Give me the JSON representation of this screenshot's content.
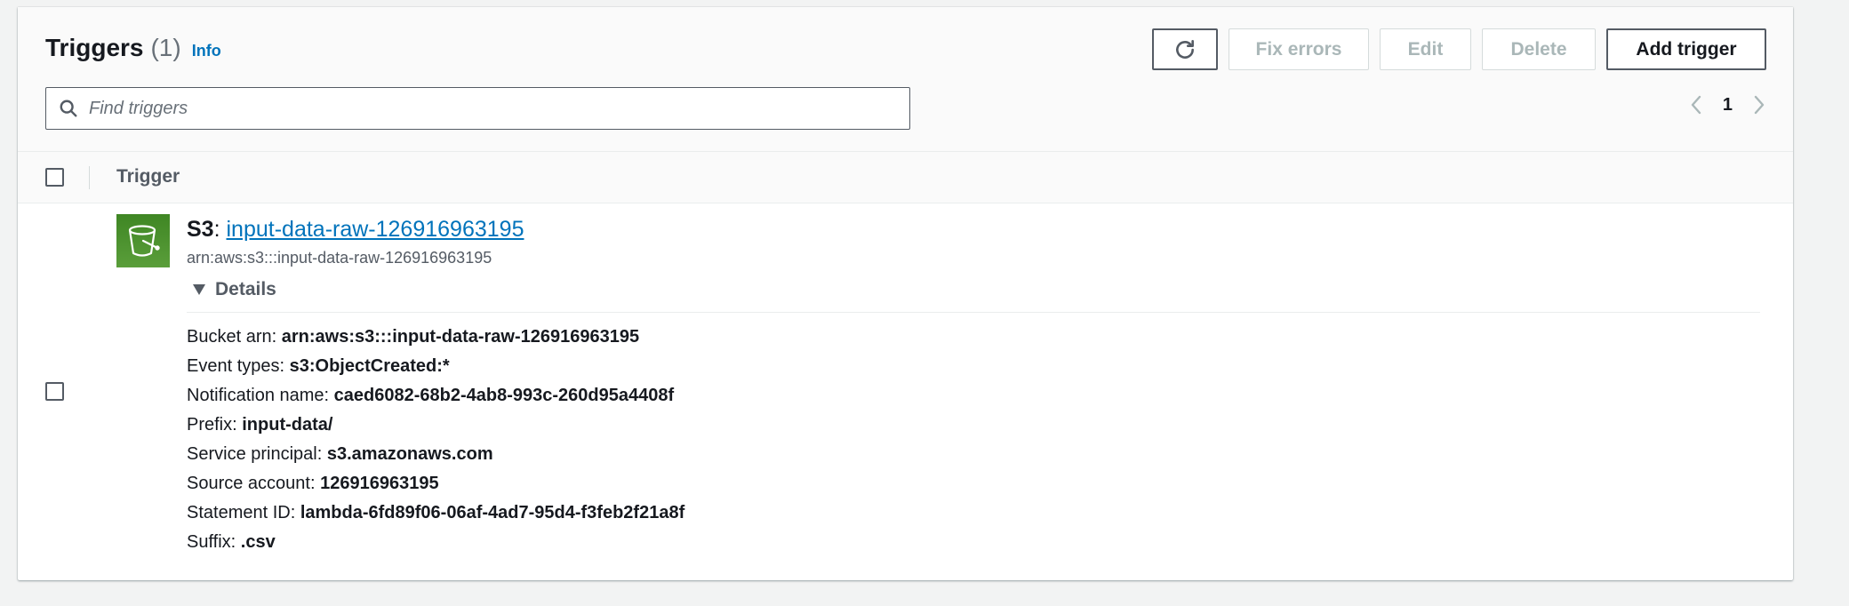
{
  "header": {
    "title": "Triggers",
    "count": "(1)",
    "info_link": "Info"
  },
  "toolbar": {
    "refresh_icon": "refresh-icon",
    "fix_errors_label": "Fix errors",
    "edit_label": "Edit",
    "delete_label": "Delete",
    "add_trigger_label": "Add trigger"
  },
  "search": {
    "placeholder": "Find triggers",
    "value": ""
  },
  "pagination": {
    "current_page": "1"
  },
  "table": {
    "columns": [
      "Trigger"
    ]
  },
  "trigger": {
    "service": "S3",
    "separator": ":",
    "name": "input-data-raw-126916963195",
    "arn": "arn:aws:s3:::input-data-raw-126916963195",
    "details_label": "Details",
    "details": [
      {
        "key": "Bucket arn:",
        "value": "arn:aws:s3:::input-data-raw-126916963195"
      },
      {
        "key": "Event types:",
        "value": "s3:ObjectCreated:*"
      },
      {
        "key": "Notification name:",
        "value": "caed6082-68b2-4ab8-993c-260d95a4408f"
      },
      {
        "key": "Prefix:",
        "value": "input-data/"
      },
      {
        "key": "Service principal:",
        "value": "s3.amazonaws.com"
      },
      {
        "key": "Source account:",
        "value": "126916963195"
      },
      {
        "key": "Statement ID:",
        "value": "lambda-6fd89f06-06af-4ad7-95d4-f3feb2f21a8f"
      },
      {
        "key": "Suffix:",
        "value": ".csv"
      }
    ]
  },
  "colors": {
    "link": "#0073bb",
    "s3_icon_bg": "#3f8624",
    "disabled_text": "#aab7b8"
  }
}
